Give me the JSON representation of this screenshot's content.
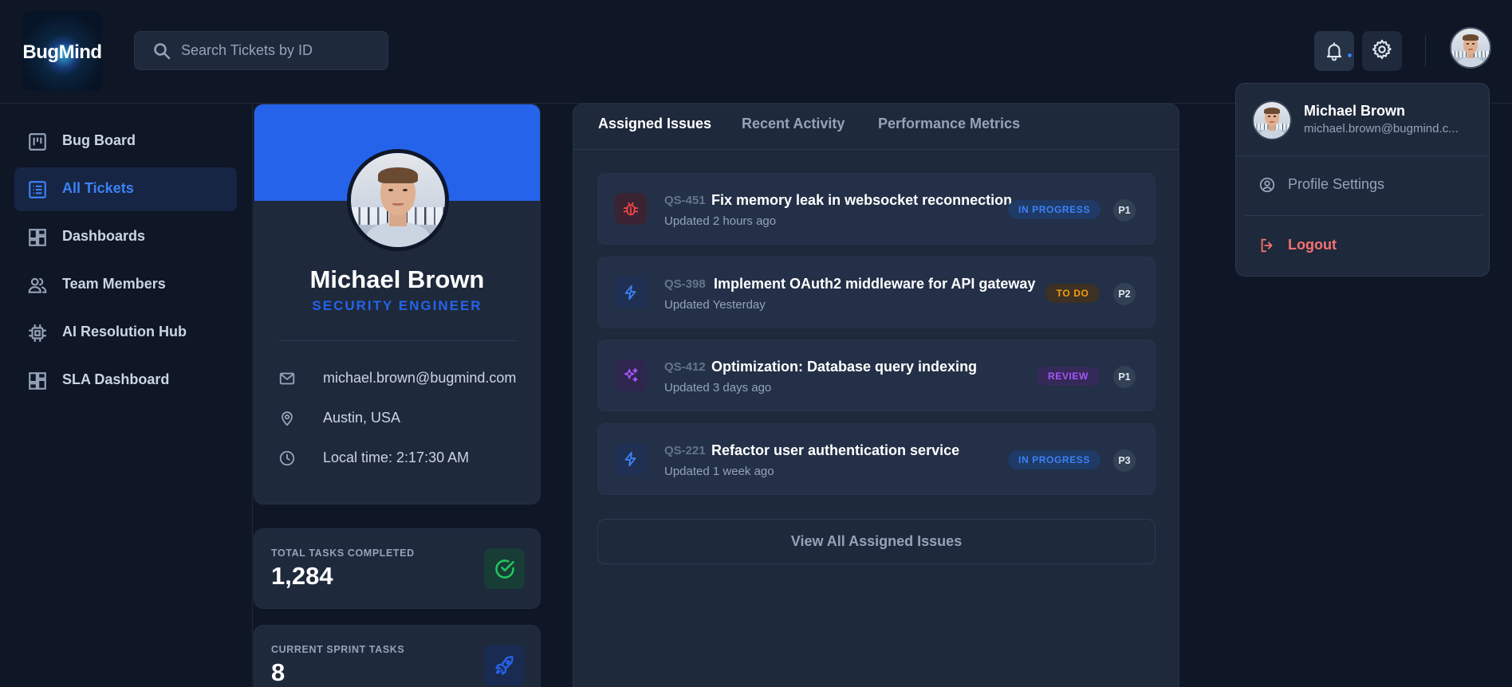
{
  "app": {
    "logo_text": "BugMind"
  },
  "search": {
    "placeholder": "Search Tickets by ID"
  },
  "sidebar": {
    "items": [
      {
        "label": "Bug Board",
        "icon": "kanban-icon",
        "active": false
      },
      {
        "label": "All Tickets",
        "icon": "list-icon",
        "active": true
      },
      {
        "label": "Dashboards",
        "icon": "dashboard-icon",
        "active": false
      },
      {
        "label": "Team Members",
        "icon": "users-icon",
        "active": false
      },
      {
        "label": "AI Resolution Hub",
        "icon": "cpu-icon",
        "active": false
      },
      {
        "label": "SLA Dashboard",
        "icon": "dashboard-icon",
        "active": false
      }
    ]
  },
  "profile": {
    "name": "Michael Brown",
    "role": "SECURITY ENGINEER",
    "email": "michael.brown@bugmind.com",
    "location": "Austin, USA",
    "local_time": "Local time: 2:17:30 AM"
  },
  "stats": {
    "total_completed_label": "TOTAL TASKS COMPLETED",
    "total_completed_value": "1,284",
    "sprint_tasks_label": "CURRENT SPRINT TASKS",
    "sprint_tasks_value": "8"
  },
  "tabs": [
    {
      "label": "Assigned Issues",
      "active": true
    },
    {
      "label": "Recent Activity",
      "active": false
    },
    {
      "label": "Performance Metrics",
      "active": false
    }
  ],
  "issues": [
    {
      "id": "QS-451",
      "title": "Fix memory leak in websocket reconnection",
      "updated": "Updated 2 hours ago",
      "status": "IN PROGRESS",
      "priority": "P1",
      "icon": "bug-icon"
    },
    {
      "id": "QS-398",
      "title": "Implement OAuth2 middleware for API gateway",
      "updated": "Updated Yesterday",
      "status": "TO DO",
      "priority": "P2",
      "icon": "lightning-icon"
    },
    {
      "id": "QS-412",
      "title": "Optimization: Database query indexing",
      "updated": "Updated 3 days ago",
      "status": "REVIEW",
      "priority": "P1",
      "icon": "sparkles-icon"
    },
    {
      "id": "QS-221",
      "title": "Refactor user authentication service",
      "updated": "Updated 1 week ago",
      "status": "IN PROGRESS",
      "priority": "P3",
      "icon": "lightning-icon"
    }
  ],
  "view_all_label": "View All Assigned Issues",
  "dropdown": {
    "name": "Michael Brown",
    "email": "michael.brown@bugmind.c...",
    "profile_settings": "Profile Settings",
    "logout": "Logout"
  },
  "colors": {
    "background": "#0f1626",
    "surface": "#1e293b",
    "accent": "#2563eb",
    "status_in_progress": "#3b82f6",
    "status_todo": "#f59e0b",
    "status_review": "#a855f7",
    "danger": "#f87171",
    "success": "#22c55e"
  }
}
